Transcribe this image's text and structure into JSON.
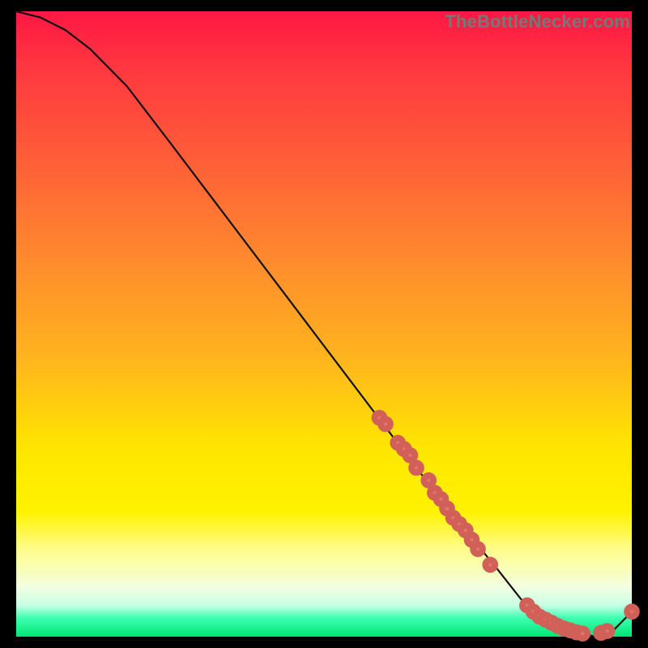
{
  "watermark": "TheBottleNecker.com",
  "colors": {
    "background": "#000000",
    "curve": "#111111",
    "point_fill": "#e2766e",
    "point_stroke": "#d06058",
    "gradient_top": "#ff1744",
    "gradient_bottom": "#00e676"
  },
  "chart_data": {
    "type": "line",
    "title": "",
    "xlabel": "",
    "ylabel": "",
    "xlim": [
      0,
      100
    ],
    "ylim": [
      0,
      100
    ],
    "curve": {
      "x": [
        0,
        4,
        8,
        12,
        18,
        25,
        35,
        45,
        55,
        65,
        73,
        78,
        82,
        86,
        90,
        94,
        97,
        100
      ],
      "y": [
        100,
        99,
        97,
        94,
        88,
        79,
        66,
        53,
        40,
        27,
        17,
        11,
        6,
        3,
        1,
        0,
        1,
        4
      ]
    },
    "points": [
      {
        "x": 59,
        "y": 35
      },
      {
        "x": 60,
        "y": 34
      },
      {
        "x": 62,
        "y": 31
      },
      {
        "x": 63,
        "y": 30
      },
      {
        "x": 64,
        "y": 29
      },
      {
        "x": 65,
        "y": 27
      },
      {
        "x": 67,
        "y": 25
      },
      {
        "x": 68,
        "y": 23
      },
      {
        "x": 69,
        "y": 22
      },
      {
        "x": 70,
        "y": 20.5
      },
      {
        "x": 71,
        "y": 19
      },
      {
        "x": 72,
        "y": 18
      },
      {
        "x": 73,
        "y": 17
      },
      {
        "x": 74,
        "y": 15.5
      },
      {
        "x": 75,
        "y": 14
      },
      {
        "x": 77,
        "y": 11.5
      },
      {
        "x": 83,
        "y": 5
      },
      {
        "x": 84,
        "y": 4
      },
      {
        "x": 85,
        "y": 3.2
      },
      {
        "x": 86,
        "y": 2.7
      },
      {
        "x": 87,
        "y": 2.2
      },
      {
        "x": 88,
        "y": 1.7
      },
      {
        "x": 89,
        "y": 1.3
      },
      {
        "x": 90,
        "y": 1
      },
      {
        "x": 91,
        "y": 0.7
      },
      {
        "x": 92,
        "y": 0.5
      },
      {
        "x": 95,
        "y": 0.6
      },
      {
        "x": 96,
        "y": 0.9
      },
      {
        "x": 100,
        "y": 4
      }
    ]
  }
}
